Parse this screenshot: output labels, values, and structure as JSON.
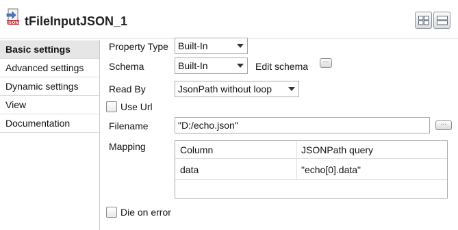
{
  "component": {
    "title": "tFileInputJSON_1",
    "icon": "json-file-icon"
  },
  "view_buttons": [
    "grid-view-icon",
    "list-view-icon"
  ],
  "sidebar": {
    "items": [
      {
        "label": "Basic settings",
        "active": true
      },
      {
        "label": "Advanced settings",
        "active": false
      },
      {
        "label": "Dynamic settings",
        "active": false
      },
      {
        "label": "View",
        "active": false
      },
      {
        "label": "Documentation",
        "active": false
      }
    ]
  },
  "form": {
    "property_type": {
      "label": "Property Type",
      "value": "Built-In"
    },
    "schema": {
      "label": "Schema",
      "value": "Built-In",
      "edit_label": "Edit schema"
    },
    "read_by": {
      "label": "Read By",
      "value": "JsonPath without loop"
    },
    "use_url": {
      "label": "Use Url",
      "checked": false
    },
    "filename": {
      "label": "Filename",
      "value": "\"D:/echo.json\""
    },
    "mapping": {
      "label": "Mapping",
      "columns": [
        "Column",
        "JSONPath query"
      ],
      "rows": [
        [
          "data",
          "\"echo[0].data\""
        ]
      ]
    },
    "die_on_error": {
      "label": "Die on error",
      "checked": false
    }
  },
  "colors": {
    "active_tab_bg": "#e6e6e6",
    "border": "#a9a9a9"
  }
}
